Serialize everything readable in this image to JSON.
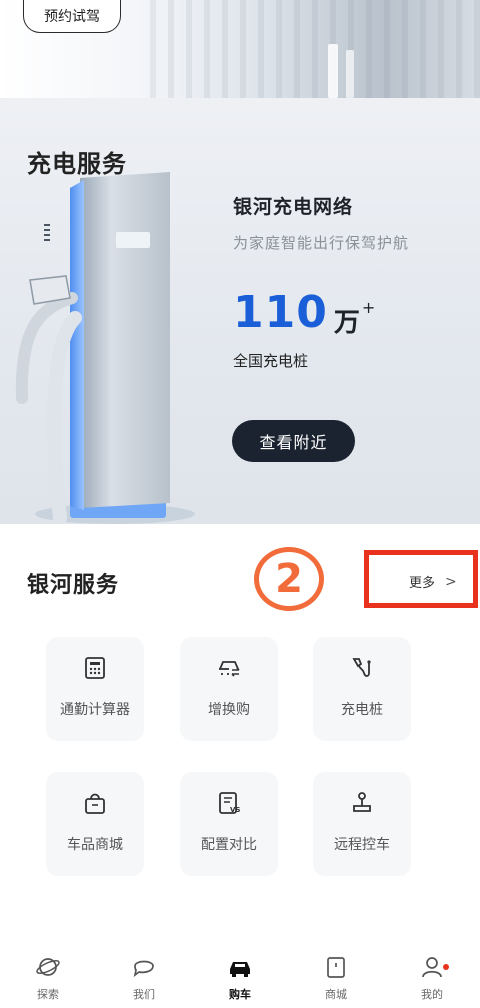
{
  "header": {
    "test_drive_label": "预约试驾"
  },
  "charging": {
    "title": "充电服务",
    "network_title": "银河充电网络",
    "network_subtitle": "为家庭智能出行保驾护航",
    "stat_value": "110",
    "stat_unit": "万",
    "stat_plus": "+",
    "stat_label": "全国充电桩",
    "nearby_button": "查看附近"
  },
  "services": {
    "title": "银河服务",
    "step_badge": "2",
    "more_label": "更多",
    "items": [
      {
        "label": "通勤计算器",
        "icon": "calculator-icon"
      },
      {
        "label": "增换购",
        "icon": "car-trade-icon"
      },
      {
        "label": "充电桩",
        "icon": "charging-plug-icon"
      },
      {
        "label": "车品商城",
        "icon": "shopping-bag-icon"
      },
      {
        "label": "配置对比",
        "icon": "compare-doc-icon"
      },
      {
        "label": "远程控车",
        "icon": "joystick-icon"
      }
    ]
  },
  "tabbar": {
    "items": [
      {
        "label": "探索",
        "icon": "planet-icon"
      },
      {
        "label": "我们",
        "icon": "chat-bubble-icon"
      },
      {
        "label": "购车",
        "icon": "car-icon"
      },
      {
        "label": "商城",
        "icon": "store-icon"
      },
      {
        "label": "我的",
        "icon": "profile-icon"
      }
    ],
    "active": "购车"
  },
  "colors": {
    "accent_blue": "#1a5fd8",
    "annotation_red": "#e8321e",
    "annotation_orange": "#f26b3a",
    "dark_button": "#1b2330"
  }
}
